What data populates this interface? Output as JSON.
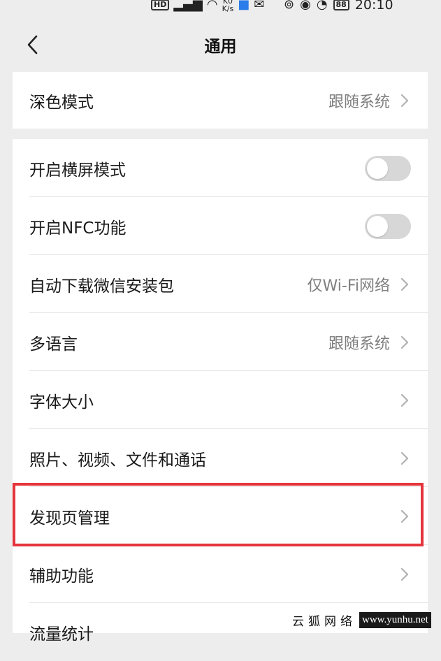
{
  "status_bar": {
    "hd_badge": "HD",
    "net_speed_top": "K0",
    "net_speed_unit": "K/s",
    "battery": "88",
    "time": "20:10"
  },
  "nav": {
    "title": "通用"
  },
  "section1": [
    {
      "label": "深色模式",
      "value": "跟随系统"
    }
  ],
  "section2": {
    "landscape": {
      "label": "开启横屏模式"
    },
    "nfc": {
      "label": "开启NFC功能"
    },
    "auto_download": {
      "label": "自动下载微信安装包",
      "value": "仅Wi-Fi网络"
    },
    "language": {
      "label": "多语言",
      "value": "跟随系统"
    },
    "font_size": {
      "label": "字体大小"
    },
    "media": {
      "label": "照片、视频、文件和通话"
    },
    "discover": {
      "label": "发现页管理"
    },
    "accessibility": {
      "label": "辅助功能"
    },
    "data_usage": {
      "label": "流量统计"
    }
  },
  "toggles": {
    "landscape": false,
    "nfc": false
  },
  "colors": {
    "background": "#ededed",
    "card": "#ffffff",
    "highlight": "#e5343b",
    "secondary_text": "#7f7f7f"
  },
  "watermark": {
    "cn": "云狐网络",
    "url": "www.yunhu.net"
  }
}
